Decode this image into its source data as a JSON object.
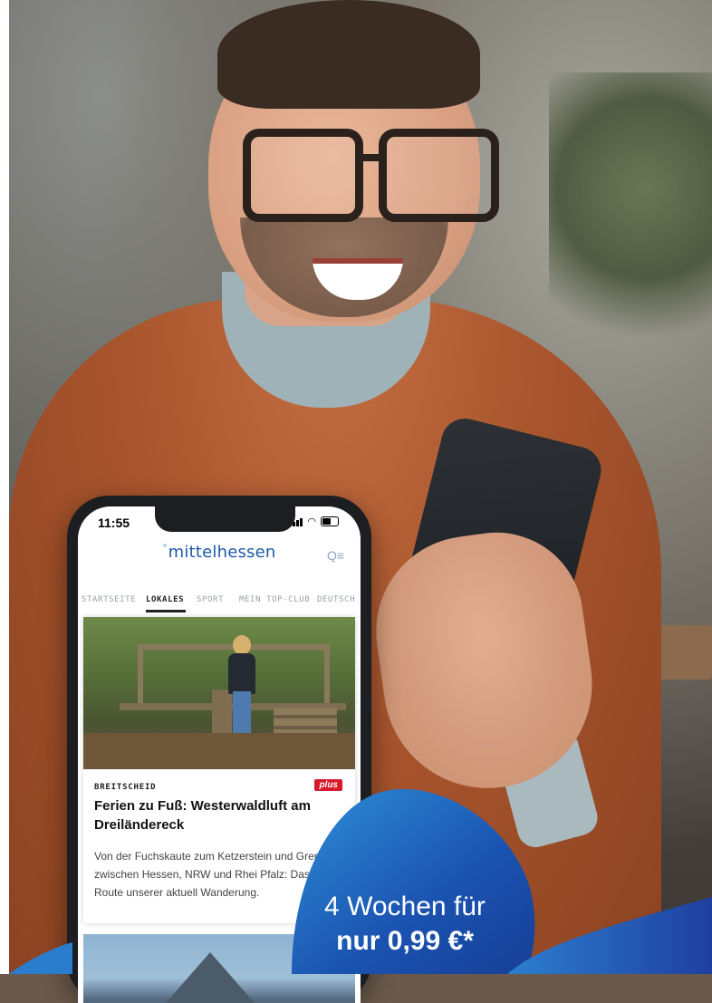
{
  "phone": {
    "status_time": "11:55",
    "app_logo": "mittelhessen",
    "nav_tabs": [
      {
        "label": "STARTSEITE"
      },
      {
        "label": "LOKALES"
      },
      {
        "label": "SPORT"
      },
      {
        "label": "MEIN TOP-CLUB"
      },
      {
        "label": "DEUTSCH"
      }
    ],
    "article": {
      "kicker": "BREITSCHEID",
      "badge": "plus",
      "headline": "Ferien zu Fuß: Westerwaldluft am Dreiländereck",
      "teaser": "Von der Fuchskaute zum Ketzerstein und Grenze zwischen Hessen, NRW und Rhei Pfalz: Das ist die Route unserer aktuell Wanderung."
    }
  },
  "promo": {
    "line1": "4 Wochen für",
    "line2": "nur 0,99 €*",
    "colors": {
      "blue_dark": "#1a52b0",
      "blue_light": "#2f8fd8"
    }
  },
  "icons": [
    "signal-icon",
    "wifi-icon",
    "battery-icon",
    "search-menu-icon"
  ]
}
